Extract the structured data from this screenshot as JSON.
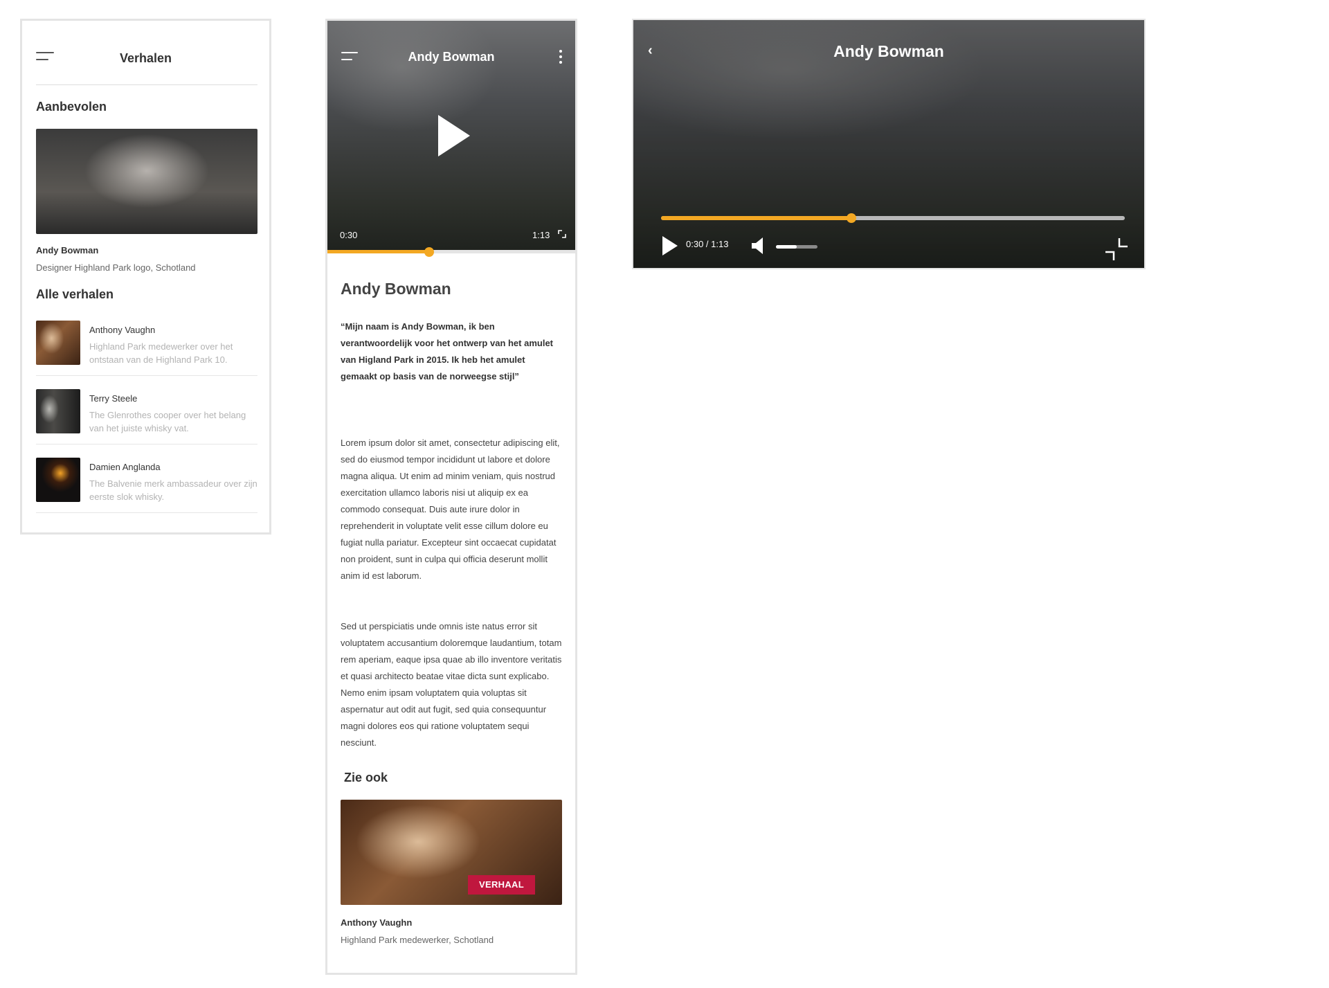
{
  "list_screen": {
    "header": {
      "title": "Verhalen",
      "menu_icon": "menu-icon"
    },
    "recommended": {
      "heading": "Aanbevolen",
      "name": "Andy Bowman",
      "subtitle": "Designer Highland Park logo, Schotland"
    },
    "all_stories": {
      "heading": "Alle verhalen",
      "items": [
        {
          "name": "Anthony Vaughn",
          "description": "Highland Park medewerker over het ontstaan van de Highland Park 10."
        },
        {
          "name": "Terry Steele",
          "description": "The Glenrothes cooper over het belang van het juiste whisky vat."
        },
        {
          "name": "Damien Anglanda",
          "description": "The Balvenie merk ambassadeur over zijn eerste slok whisky."
        }
      ]
    }
  },
  "detail_screen": {
    "video": {
      "title": "Andy Bowman",
      "current_time": "0:30",
      "duration": "1:13",
      "progress": 0.41
    },
    "name": "Andy Bowman",
    "quote": "“Mijn naam is Andy Bowman, ik ben verantwoordelijk voor het ontwerp van het amulet van Higland Park in 2015. Ik heb het amulet gemaakt op basis van de norweegse stijl”",
    "body": [
      "Lorem ipsum dolor sit amet, consectetur adipiscing elit, sed do eiusmod tempor incididunt ut labore et dolore magna aliqua. Ut enim ad minim veniam, quis nostrud exercitation ullamco laboris nisi ut aliquip ex ea commodo consequat. Duis aute irure dolor in reprehenderit in voluptate velit esse cillum dolore eu fugiat nulla pariatur. Excepteur sint occaecat cupidatat non proident, sunt in culpa qui officia deserunt mollit anim id est laborum.",
      "Sed ut perspiciatis unde omnis iste natus error sit voluptatem accusantium doloremque laudantium, totam rem aperiam, eaque ipsa quae ab illo inventore veritatis et quasi architecto beatae vitae dicta sunt explicabo. Nemo enim ipsam voluptatem quia voluptas sit aspernatur aut odit aut fugit, sed quia consequuntur magni dolores eos qui ratione voluptatem sequi nesciunt."
    ],
    "see_also": {
      "heading": "Zie ook",
      "tag": "VERHAAL",
      "name": "Anthony Vaughn",
      "subtitle": "Highland Park medewerker, Schotland"
    }
  },
  "fullscreen_player": {
    "title": "Andy Bowman",
    "back_icon": "‹",
    "time": "0:30 / 1:13",
    "progress": 0.41,
    "volume": 0.5
  },
  "colors": {
    "accent": "#f3a823",
    "tag": "#c0173e",
    "muted_text": "#b3b3b3"
  }
}
